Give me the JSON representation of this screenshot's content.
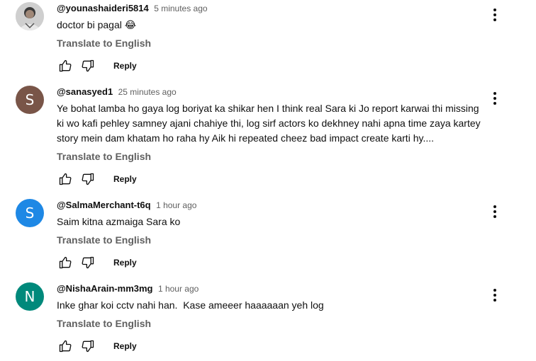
{
  "comments": [
    {
      "author": "@younashaideri5814",
      "time": "5 minutes ago",
      "text": "doctor bi pagal 😂",
      "translate": "Translate to English",
      "reply": "Reply",
      "avatar_letter": "",
      "avatar_color": "#d9d9d9"
    },
    {
      "author": "@sanasyed1",
      "time": "25 minutes ago",
      "text": "Ye bohat lamba ho gaya log boriyat ka shikar hen I think real Sara ki Jo report karwai thi missing ki wo kafi pehley samney ajani chahiye thi, log sirf actors ko dekhney nahi apna time zaya kartey story mein dam khatam ho raha hy Aik hi repeated cheez bad impact create karti hy....",
      "translate": "Translate to English",
      "reply": "Reply",
      "avatar_letter": "S",
      "avatar_color": "#795548"
    },
    {
      "author": "@SalmaMerchant-t6q",
      "time": "1 hour ago",
      "text": "Saim kitna azmaiga Sara ko",
      "translate": "Translate to English",
      "reply": "Reply",
      "avatar_letter": "S",
      "avatar_color": "#1e88e5"
    },
    {
      "author": "@NishaArain-mm3mg",
      "time": "1 hour ago",
      "text": "Inke ghar koi cctv nahi han.  Kase ameeer haaaaaan yeh log",
      "translate": "Translate to English",
      "reply": "Reply",
      "avatar_letter": "N",
      "avatar_color": "#00897b"
    }
  ]
}
